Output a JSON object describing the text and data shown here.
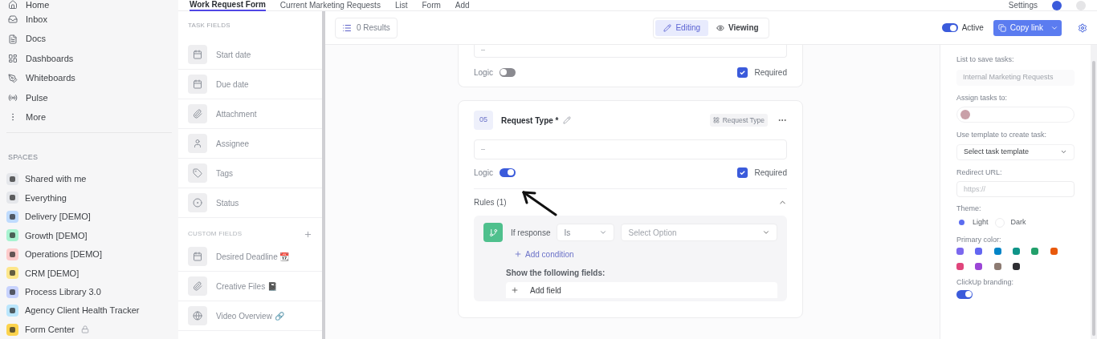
{
  "sidebar": {
    "items": [
      {
        "label": "Home"
      },
      {
        "label": "Inbox"
      },
      {
        "label": "Docs"
      },
      {
        "label": "Dashboards"
      },
      {
        "label": "Whiteboards"
      },
      {
        "label": "Pulse"
      },
      {
        "label": "More"
      }
    ],
    "spaces_heading": "SPACES",
    "spaces": [
      {
        "label": "Shared with me",
        "color": "#e5e7eb",
        "locked": false
      },
      {
        "label": "Everything",
        "color": "#e5e7eb",
        "locked": false
      },
      {
        "label": "Delivery [DEMO]",
        "color": "#bfdbfe",
        "locked": false
      },
      {
        "label": "Growth [DEMO]",
        "color": "#a7f3d0",
        "locked": false
      },
      {
        "label": "Operations [DEMO]",
        "color": "#fecaca",
        "locked": false
      },
      {
        "label": "CRM [DEMO]",
        "color": "#fde68a",
        "locked": false
      },
      {
        "label": "Process Library 3.0",
        "color": "#c7d2fe",
        "locked": false
      },
      {
        "label": "Agency Client Health Tracker",
        "color": "#bae6fd",
        "locked": false
      },
      {
        "label": "Form Center",
        "color": "#fcd34d",
        "locked": true
      }
    ]
  },
  "tabs": [
    {
      "label": "Work Request Form",
      "selected": true
    },
    {
      "label": "Current Marketing Requests",
      "selected": false
    },
    {
      "label": "List",
      "selected": false
    },
    {
      "label": "Form",
      "selected": false
    },
    {
      "label": "Add",
      "selected": false
    }
  ],
  "header_settings": "Settings",
  "task_fields": {
    "heading": "TASK FIELDS",
    "items": [
      {
        "label": "Start date"
      },
      {
        "label": "Due date"
      },
      {
        "label": "Attachment"
      },
      {
        "label": "Assignee"
      },
      {
        "label": "Tags"
      },
      {
        "label": "Status"
      }
    ]
  },
  "custom_fields": {
    "heading": "CUSTOM FIELDS",
    "items": [
      {
        "label": "Desired Deadline 📆"
      },
      {
        "label": "Creative Files 📓"
      },
      {
        "label": "Video Overview 🔗"
      }
    ]
  },
  "toolbar": {
    "results": "0 Results",
    "modes": [
      {
        "label": "Editing",
        "selected": true
      },
      {
        "label": "Viewing",
        "selected": false
      }
    ],
    "active": {
      "label": "Active",
      "on": true
    },
    "copy_link": "Copy link"
  },
  "cards": [
    {
      "value": "–",
      "logic_label": "Logic",
      "logic_on": false,
      "required_label": "Required",
      "required": true
    },
    {
      "number": "05",
      "title": "Request Type *",
      "type_tag": "Request Type",
      "value": "–",
      "logic_label": "Logic",
      "logic_on": true,
      "required_label": "Required",
      "required": true,
      "rules": {
        "title": "Rules (1)",
        "expanded": true,
        "condition": "If response",
        "operator": "Is",
        "option_placeholder": "Select Option",
        "add_condition": "Add condition",
        "show_fields": "Show the following fields:",
        "add_field": "Add field"
      }
    }
  ],
  "settings_panel": {
    "list_label": "List to save tasks:",
    "list_value": "Internal Marketing Requests",
    "assign_label": "Assign tasks to:",
    "template_label": "Use template to create task:",
    "template_value": "Select task template",
    "redirect_label": "Redirect URL:",
    "redirect_placeholder": "https://",
    "theme_label": "Theme:",
    "themes": [
      {
        "label": "Light",
        "selected": true
      },
      {
        "label": "Dark",
        "selected": false
      }
    ],
    "primary_label": "Primary color:",
    "colors": [
      {
        "color": "#7b68ee"
      },
      {
        "color": "#6366f1"
      },
      {
        "color": "#0284c7"
      },
      {
        "color": "#0f9488"
      },
      {
        "color": "#22a06b"
      },
      {
        "color": "#e8590c"
      },
      {
        "color": "#e0457b"
      },
      {
        "color": "#9b46d6"
      },
      {
        "color": "#8d7b72"
      },
      {
        "color": "#2f2f33"
      }
    ],
    "branding_label": "ClickUp branding:",
    "branding_on": true
  }
}
